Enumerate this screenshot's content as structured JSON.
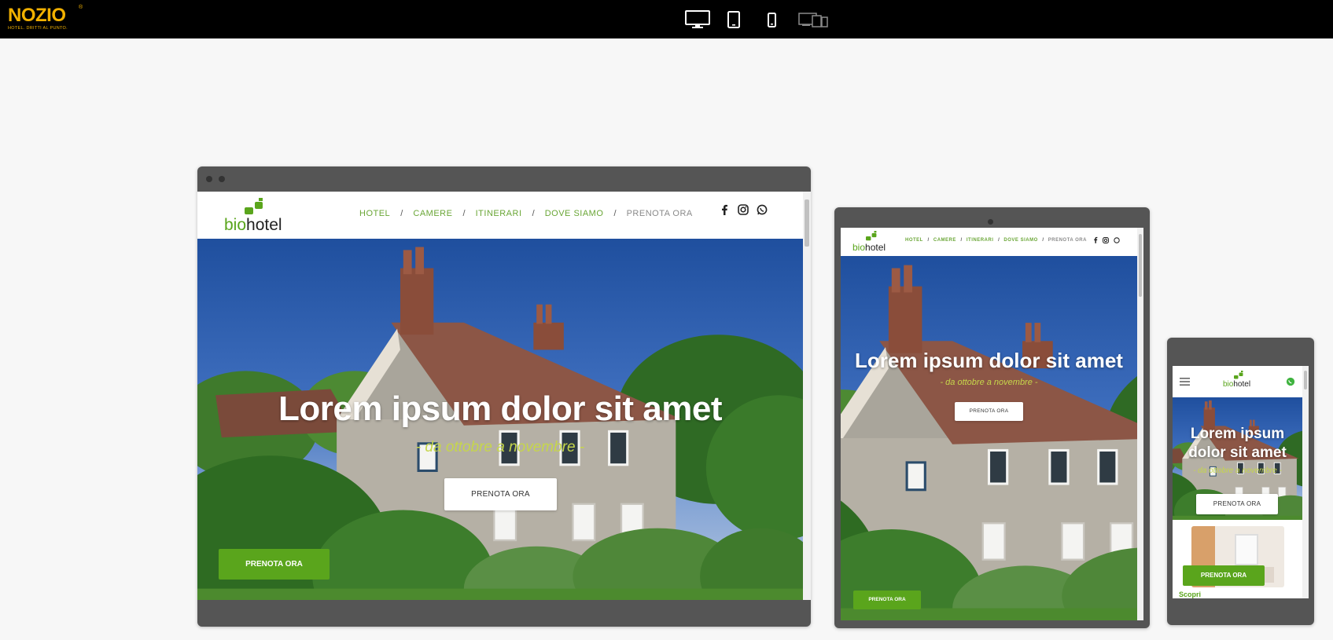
{
  "app": {
    "logo_text": "NOZIO",
    "logo_reg": "®",
    "logo_tagline": "HOTEL. DRITTI AL PUNTO."
  },
  "device_toggle": {
    "items": [
      {
        "name": "desktop-icon",
        "state": "active"
      },
      {
        "name": "tablet-icon",
        "state": "inactive"
      },
      {
        "name": "mobile-icon",
        "state": "inactive"
      },
      {
        "name": "multi-device-icon",
        "state": "inactive"
      }
    ]
  },
  "site": {
    "brand_bio": "bio",
    "brand_hotel": "hotel",
    "nav": [
      {
        "label": "HOTEL"
      },
      {
        "label": "CAMERE"
      },
      {
        "label": "ITINERARI"
      },
      {
        "label": "DOVE SIAMO"
      },
      {
        "label": "PRENOTA ORA"
      }
    ],
    "nav_separator": "/",
    "social": [
      "facebook-icon",
      "instagram-icon",
      "whatsapp-icon"
    ],
    "hero_title": "Lorem ipsum dolor sit amet",
    "hero_subtitle": "- da ottobre a novembre -",
    "cta_label": "PRENOTA ORA",
    "sticky_cta_label": "PRENOTA ORA",
    "mobile_hero_title_line1": "Lorem ipsum",
    "mobile_hero_title_line2": "dolor sit amet",
    "mobile_next_heading": "Scopri"
  },
  "colors": {
    "brand_green": "#5aa51c",
    "nav_green": "#6aa636",
    "subtitle_yellow": "#c6d64b",
    "frame_gray": "#555555",
    "topbar_black": "#000000",
    "logo_yellow": "#f2b100"
  }
}
